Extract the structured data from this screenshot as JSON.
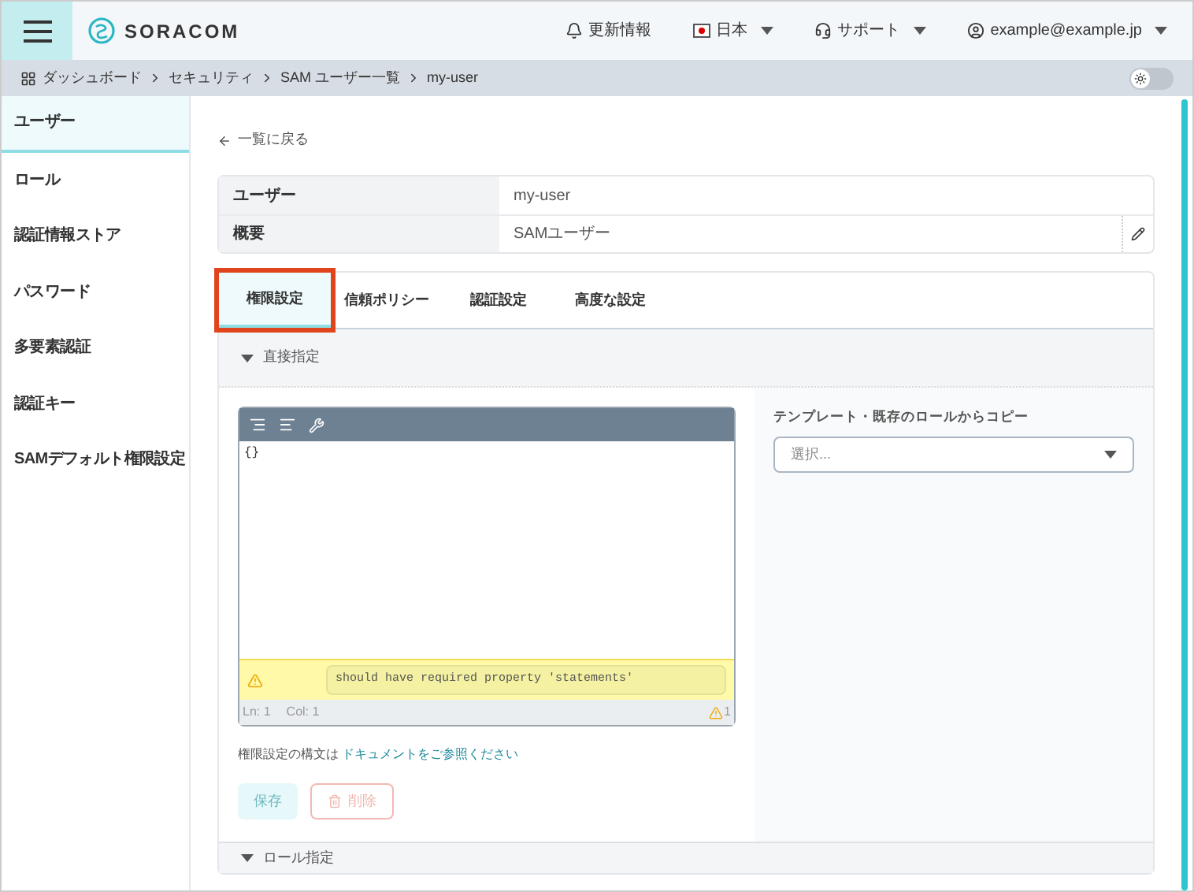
{
  "header": {
    "logo": "SORACOM",
    "nav": [
      {
        "kind": "bell",
        "label": "更新情報",
        "dropdown": false
      },
      {
        "kind": "flag",
        "label": "日本",
        "dropdown": true
      },
      {
        "kind": "support",
        "label": "サポート",
        "dropdown": true
      },
      {
        "kind": "user",
        "label": "example@example.jp",
        "dropdown": true
      }
    ]
  },
  "breadcrumb": [
    "ダッシュボード",
    "セキュリティ",
    "SAM ユーザー一覧",
    "my-user"
  ],
  "theme_toggle": {
    "on": false
  },
  "sidebar": {
    "items": [
      {
        "label": "ユーザー",
        "selected": true
      },
      {
        "label": "ロール",
        "selected": false
      },
      {
        "label": "認証情報ストア",
        "selected": false
      },
      {
        "label": "パスワード",
        "selected": false
      },
      {
        "label": "多要素認証",
        "selected": false
      },
      {
        "label": "認証キー",
        "selected": false
      },
      {
        "label": "SAMデフォルト権限設定",
        "selected": false
      }
    ]
  },
  "back_link": "一覧に戻る",
  "info_rows": [
    {
      "label": "ユーザー",
      "value": "my-user",
      "editable": false
    },
    {
      "label": "概要",
      "value": "SAMユーザー",
      "editable": true
    }
  ],
  "tabs": [
    {
      "label": "権限設定",
      "selected": true,
      "highlighted": true
    },
    {
      "label": "信頼ポリシー",
      "selected": false,
      "highlighted": false
    },
    {
      "label": "認証設定",
      "selected": false,
      "highlighted": false
    },
    {
      "label": "高度な設定",
      "selected": false,
      "highlighted": false
    }
  ],
  "direct_section": {
    "title": "直接指定",
    "expanded": true
  },
  "editor": {
    "content": "{}",
    "warning": "should have required property 'statements'",
    "line": "Ln: 1",
    "column": "Col: 1",
    "warning_count": "1"
  },
  "doc_note": {
    "text": "権限設定の構文は",
    "link": "ドキュメントをご参照ください"
  },
  "buttons": [
    {
      "kind": "save",
      "label": "保存",
      "disabled": true
    },
    {
      "kind": "delete",
      "label": "削除",
      "disabled": true
    }
  ],
  "copy_panel": {
    "label": "テンプレート・既存のロールからコピー",
    "placeholder": "選択..."
  },
  "role_section": {
    "title": "ロール指定",
    "expanded": true
  }
}
